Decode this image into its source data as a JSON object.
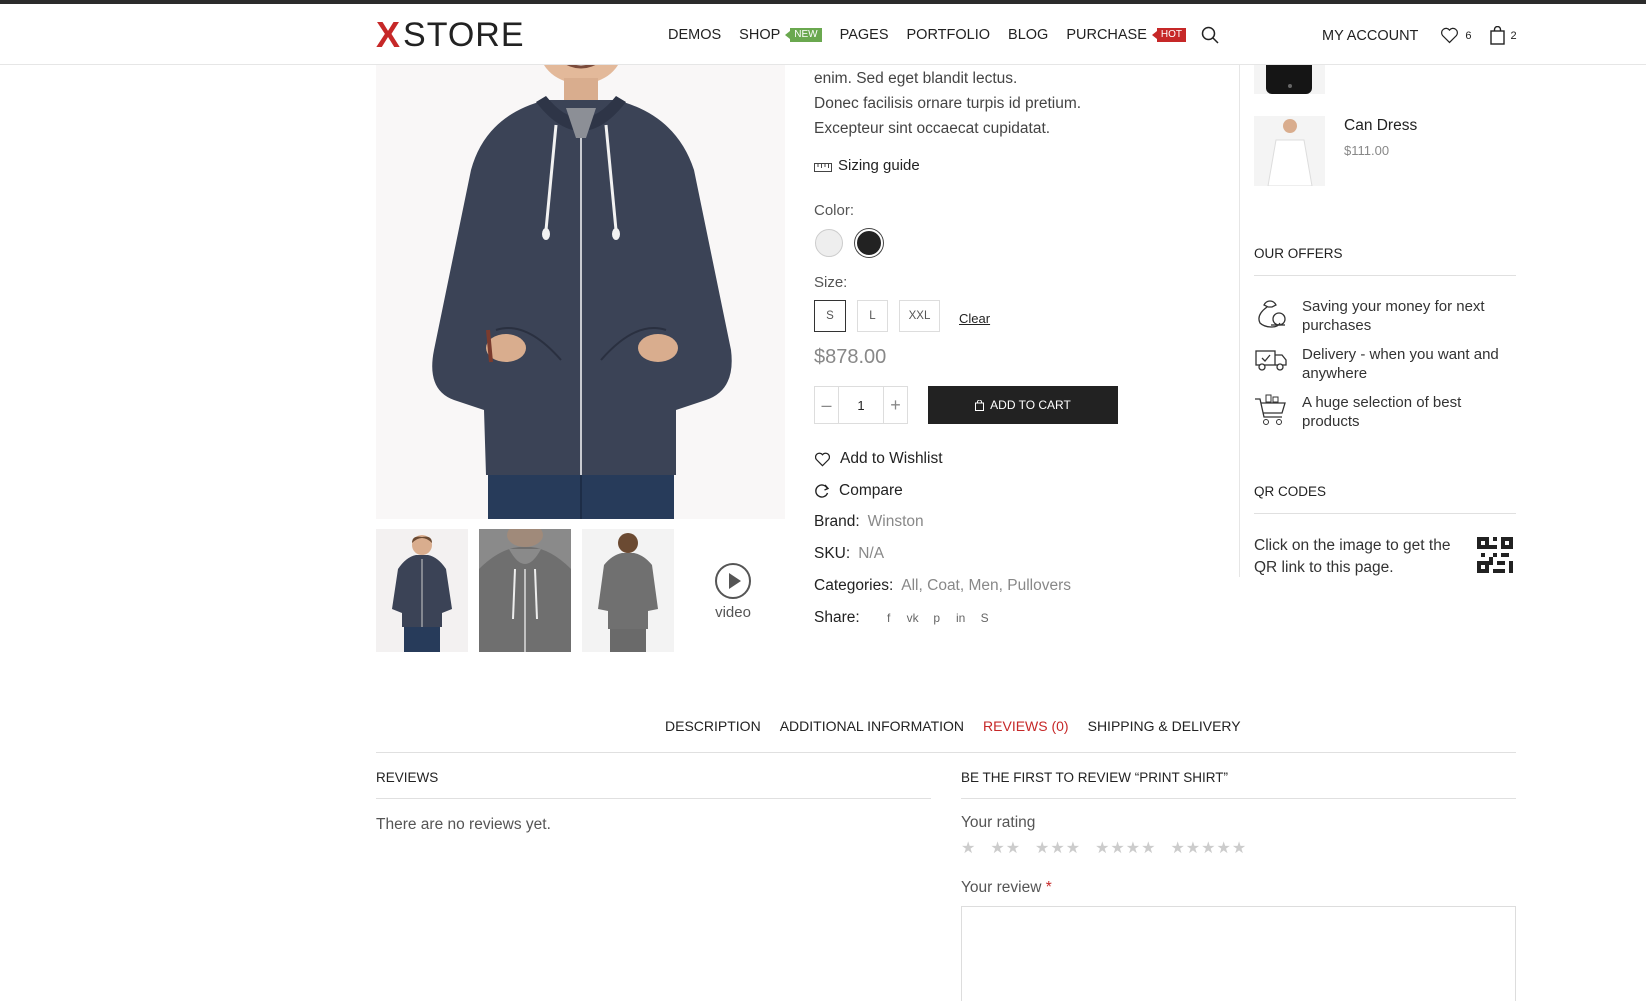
{
  "header": {
    "logo_x": "X",
    "logo_text": "STORE",
    "nav": [
      {
        "label": "Demos",
        "badge": null
      },
      {
        "label": "Shop",
        "badge": "NEW"
      },
      {
        "label": "Pages",
        "badge": null
      },
      {
        "label": "Portfolio",
        "badge": null
      },
      {
        "label": "Blog",
        "badge": null
      },
      {
        "label": "Purchase",
        "badge": "HOT"
      }
    ],
    "account_label": "MY ACCOUNT",
    "wishlist_count": "6",
    "cart_count": "2"
  },
  "product": {
    "desc_lines": [
      "enim. Sed eget blandit lectus.",
      "Donec facilisis ornare turpis id pretium.",
      "Excepteur sint occaecat cupidatat."
    ],
    "sizing_guide": "Sizing guide",
    "color_label": "Color:",
    "colors": [
      "#eeeeee",
      "#222222"
    ],
    "size_label": "Size:",
    "sizes": [
      "S",
      "L",
      "XXL"
    ],
    "clear_label": "Clear",
    "price": "$878.00",
    "qty": "1",
    "add_to_cart": "ADD TO CART",
    "wishlist": "Add to Wishlist",
    "compare": "Compare",
    "brand_label": "Brand:",
    "brand": "Winston",
    "sku_label": "SKU:",
    "sku": "N/A",
    "categories_label": "Categories:",
    "categories": [
      "All",
      "Coat",
      "Men",
      "Pullovers"
    ],
    "share_label": "Share:",
    "video_label": "video"
  },
  "sidebar": {
    "product_name": "Can Dress",
    "product_price": "$111.00",
    "offers_title": "OUR OFFERS",
    "offers": [
      "Saving your money for next purchases",
      "Delivery - when you want and anywhere",
      "A huge selection of best products"
    ],
    "qr_title": "QR CODES",
    "qr_text": "Click on the image to get the QR link to this page."
  },
  "tabs": [
    "DESCRIPTION",
    "ADDITIONAL INFORMATION",
    "REVIEWS (0)",
    "SHIPPING & DELIVERY"
  ],
  "reviews": {
    "title": "REVIEWS",
    "empty": "There are no reviews yet.",
    "form_title": "BE THE FIRST TO REVIEW “PRINT SHIRT”",
    "rating_label": "Your rating",
    "review_label": "Your review",
    "required_mark": "*"
  },
  "colors": {
    "accent": "#c62828",
    "new_badge": "#6aa84f",
    "button": "#222222"
  }
}
